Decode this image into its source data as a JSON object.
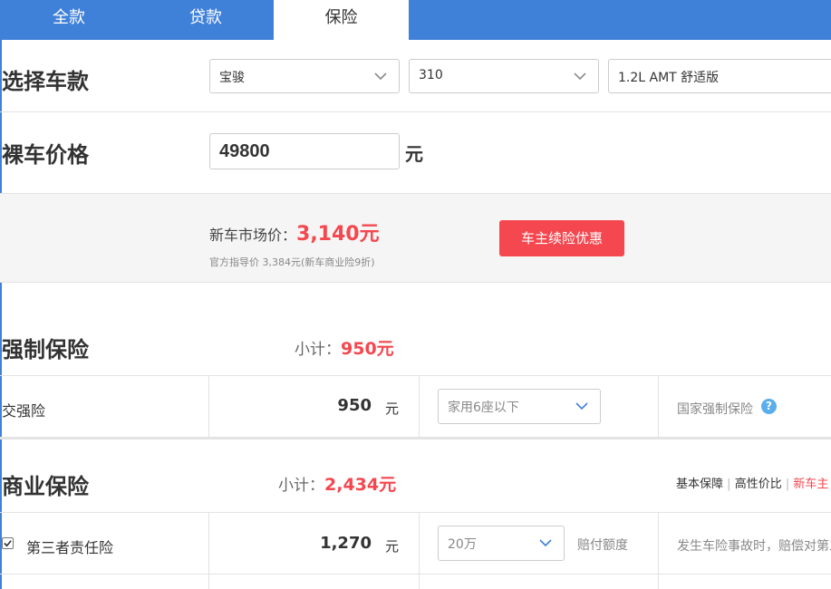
{
  "tabs": [
    {
      "label": "全款",
      "active": false
    },
    {
      "label": "贷款",
      "active": false
    },
    {
      "label": "保险",
      "active": true
    }
  ],
  "car_select": {
    "title": "选择车款",
    "brand": "宝骏",
    "model": "310",
    "trim": "1.2L AMT 舒适版"
  },
  "price": {
    "title": "裸车价格",
    "value": "49800",
    "unit": "元"
  },
  "promo": {
    "market_label": "新车市场价：",
    "market_value": "3,140元",
    "guide_text": "官方指导价 3,384元(新车商业险9折)",
    "button": "车主续险优惠"
  },
  "compulsory": {
    "title": "强制保险",
    "subtotal_label": "小计：",
    "subtotal_value": "950元",
    "row": {
      "name": "交强险",
      "amount": "950",
      "unit": "元",
      "select": "家用6座以下",
      "note": "国家强制保险",
      "help_icon": "?"
    }
  },
  "commercial": {
    "title": "商业保险",
    "subtotal_label": "小计：",
    "subtotal_value": "2,434元",
    "filters": {
      "basic": "基本保障",
      "value": "高性价比",
      "new": "新车主",
      "sep": "|"
    },
    "row": {
      "checked": true,
      "name": "第三者责任险",
      "amount": "1,270",
      "unit": "元",
      "select": "20万",
      "select_label": "赔付额度",
      "note": "发生车险事故时，赔偿对第三"
    }
  },
  "colors": {
    "tab_blue": "#3f80d9",
    "accent_red": "#f5474f",
    "help_blue": "#5aaeea"
  }
}
